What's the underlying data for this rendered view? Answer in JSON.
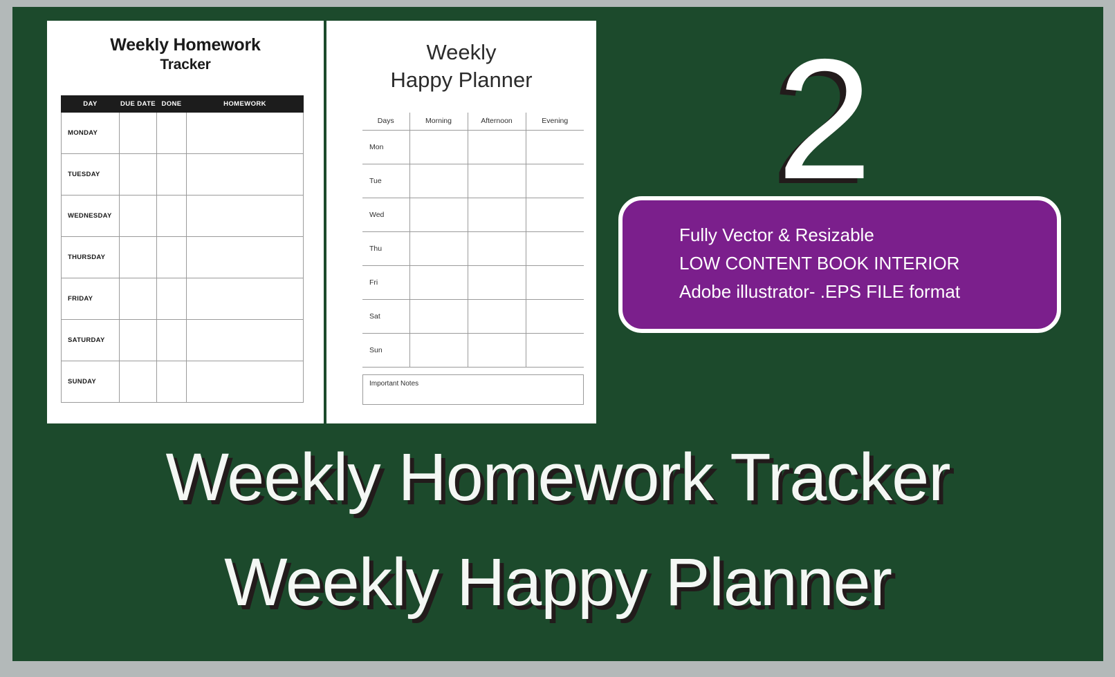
{
  "theme": {
    "background_green": "#1c4a2c",
    "outer_border_gray": "#b3b9b9",
    "badge_purple": "#7b1f8c",
    "card_white": "#ffffff",
    "header_black": "#1c1c1c",
    "shadow_dark": "#221b1b"
  },
  "homework_card": {
    "title_line1": "Weekly Homework",
    "title_line2": "Tracker",
    "columns": [
      "DAY",
      "DUE DATE",
      "DONE",
      "HOMEWORK"
    ],
    "rows": [
      {
        "day": "MONDAY",
        "due_date": "",
        "done": "",
        "homework": ""
      },
      {
        "day": "TUESDAY",
        "due_date": "",
        "done": "",
        "homework": ""
      },
      {
        "day": "WEDNESDAY",
        "due_date": "",
        "done": "",
        "homework": ""
      },
      {
        "day": "THURSDAY",
        "due_date": "",
        "done": "",
        "homework": ""
      },
      {
        "day": "FRIDAY",
        "due_date": "",
        "done": "",
        "homework": ""
      },
      {
        "day": "SATURDAY",
        "due_date": "",
        "done": "",
        "homework": ""
      },
      {
        "day": "SUNDAY",
        "due_date": "",
        "done": "",
        "homework": ""
      }
    ]
  },
  "happy_card": {
    "title_line1": "Weekly",
    "title_line2": "Happy Planner",
    "columns": [
      "Days",
      "Morning",
      "Afternoon",
      "Evening"
    ],
    "rows": [
      {
        "day": "Mon",
        "morning": "",
        "afternoon": "",
        "evening": ""
      },
      {
        "day": "Tue",
        "morning": "",
        "afternoon": "",
        "evening": ""
      },
      {
        "day": "Wed",
        "morning": "",
        "afternoon": "",
        "evening": ""
      },
      {
        "day": "Thu",
        "morning": "",
        "afternoon": "",
        "evening": ""
      },
      {
        "day": "Fri",
        "morning": "",
        "afternoon": "",
        "evening": ""
      },
      {
        "day": "Sat",
        "morning": "",
        "afternoon": "",
        "evening": ""
      },
      {
        "day": "Sun",
        "morning": "",
        "afternoon": "",
        "evening": ""
      }
    ],
    "notes_label": "Important Notes"
  },
  "numeral": "2",
  "badge": {
    "line1": "Fully Vector & Resizable",
    "line2": "LOW CONTENT BOOK INTERIOR",
    "line3": "Adobe illustrator- .EPS FILE format"
  },
  "bottom_title": {
    "line1": "Weekly Homework Tracker",
    "line2": "Weekly Happy Planner"
  }
}
